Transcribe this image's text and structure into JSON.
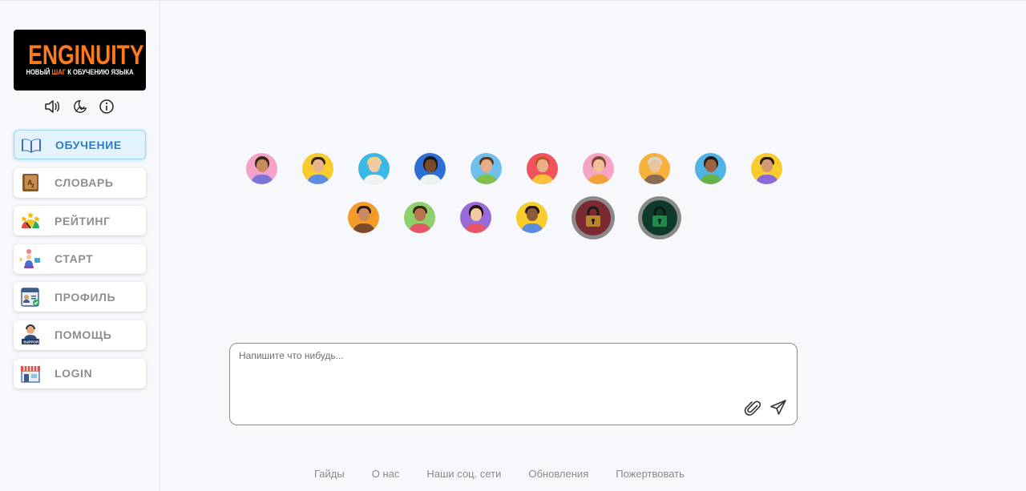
{
  "logo": {
    "word": "ENGINUITY",
    "tag_before": "НОВЫЙ ",
    "tag_highlight": "ШАГ",
    "tag_after": " К ОБУЧЕНИЮ ЯЗЫКА"
  },
  "toolbar_icons": [
    "speaker-icon",
    "theme-moon-icon",
    "info-icon"
  ],
  "nav": {
    "items": [
      {
        "label": "ОБУЧЕНИЕ",
        "icon": "book-icon",
        "active": true
      },
      {
        "label": "СЛОВАРЬ",
        "icon": "dictionary-icon"
      },
      {
        "label": "РЕЙТИНГ",
        "icon": "rating-gauge-icon"
      },
      {
        "label": "СТАРТ",
        "icon": "start-icon"
      },
      {
        "label": "ПРОФИЛЬ",
        "icon": "profile-card-icon"
      },
      {
        "label": "ПОМОЩЬ",
        "icon": "support-icon"
      },
      {
        "label": "LOGIN",
        "icon": "store-login-icon"
      }
    ]
  },
  "composer": {
    "placeholder": "Напишите что нибудь..."
  },
  "footer": {
    "links": [
      "Гайды",
      "О нас",
      "Наши соц. сети",
      "Обновления",
      "Пожертвовать"
    ]
  },
  "colors": {
    "accent": "#2b7cc9",
    "brand_orange": "#ff7a1a",
    "nav_label": "#8e8e8e"
  }
}
